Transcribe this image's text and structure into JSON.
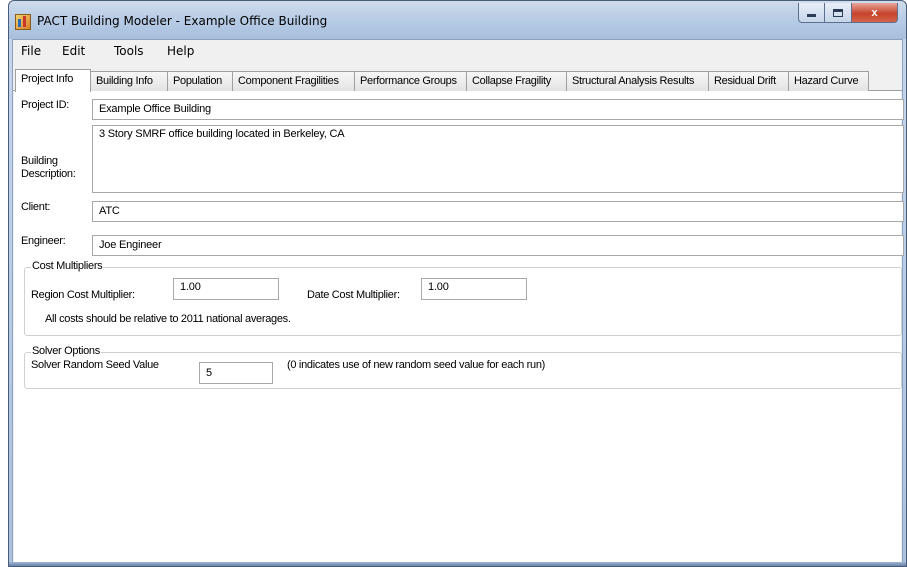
{
  "window": {
    "title": "PACT Building Modeler - Example Office Building",
    "icon": "pact-app-icon",
    "controls": {
      "minimize": "minimize-icon",
      "maximize": "maximize-icon",
      "close": "x"
    }
  },
  "menu": [
    "File",
    "Edit",
    "Tools",
    "Help"
  ],
  "tabs": [
    "Project Info",
    "Building Info",
    "Population",
    "Component Fragilities",
    "Performance Groups",
    "Collapse Fragility",
    "Structural Analysis Results",
    "Residual Drift",
    "Hazard Curve"
  ],
  "active_tab": "Project Info",
  "project": {
    "project_id_label": "Project ID:",
    "project_id_value": "Example Office Building",
    "description_label_line1": "Building",
    "description_label_line2": "Description:",
    "description_value": "3 Story SMRF office building located in Berkeley, CA",
    "client_label": "Client:",
    "client_value": "ATC",
    "engineer_label": "Engineer:",
    "engineer_value": "Joe Engineer"
  },
  "cost_multipliers": {
    "group_title": "Cost Multipliers",
    "region_label": "Region Cost Multiplier:",
    "region_value": "1.00",
    "date_label": "Date Cost Multiplier:",
    "date_value": "1.00",
    "note": "All costs should be relative to 2011 national averages."
  },
  "solver_options": {
    "group_title": "Solver Options",
    "seed_label": "Solver Random Seed Value",
    "seed_value": "5",
    "seed_note": "(0 indicates use of new random seed value for each run)"
  }
}
